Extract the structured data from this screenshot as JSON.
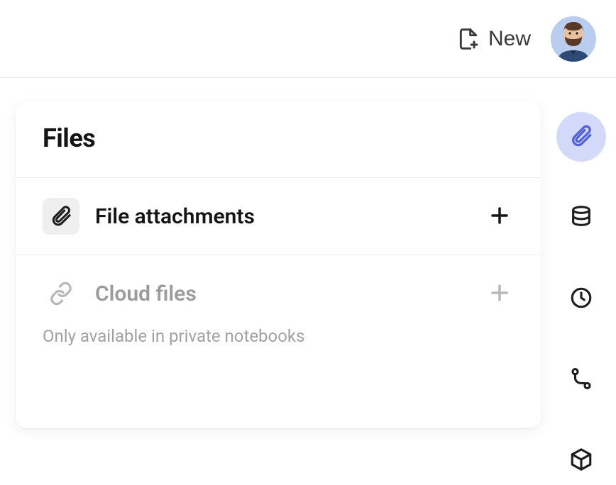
{
  "header": {
    "new_label": "New"
  },
  "card": {
    "title": "Files",
    "sections": [
      {
        "title": "File attachments",
        "icon": "paperclip-icon",
        "disabled": false
      },
      {
        "title": "Cloud files",
        "icon": "link-icon",
        "disabled": true,
        "note": "Only available in private notebooks"
      }
    ]
  },
  "rail": {
    "items": [
      {
        "name": "attachments",
        "active": true
      },
      {
        "name": "database",
        "active": false
      },
      {
        "name": "history",
        "active": false
      },
      {
        "name": "git",
        "active": false
      },
      {
        "name": "packages",
        "active": false
      }
    ]
  }
}
